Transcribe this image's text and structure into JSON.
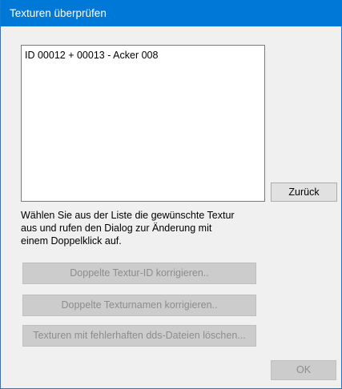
{
  "window": {
    "title": "Texturen überprüfen"
  },
  "list": {
    "items": [
      {
        "label": "ID 00012 + 00013  -  Acker 008"
      }
    ]
  },
  "buttons": {
    "back_label": "Zurück",
    "fix_duplicate_id_label": "Doppelte Textur-ID korrigieren..",
    "fix_duplicate_names_label": "Doppelte Texturnamen korrigieren..",
    "delete_faulty_dds_label": "Texturen mit fehlerhaften dds-Dateien löschen...",
    "ok_label": "OK"
  },
  "hint_text": "Wählen Sie aus der Liste die gewünschte Textur aus und rufen den Dialog zur Änderung mit einem Doppelklick auf.",
  "colors": {
    "titlebar": "#0078d7",
    "window_bg": "#f0f0f0",
    "disabled_button": "#cccccc",
    "disabled_text": "#8d8d8d"
  }
}
